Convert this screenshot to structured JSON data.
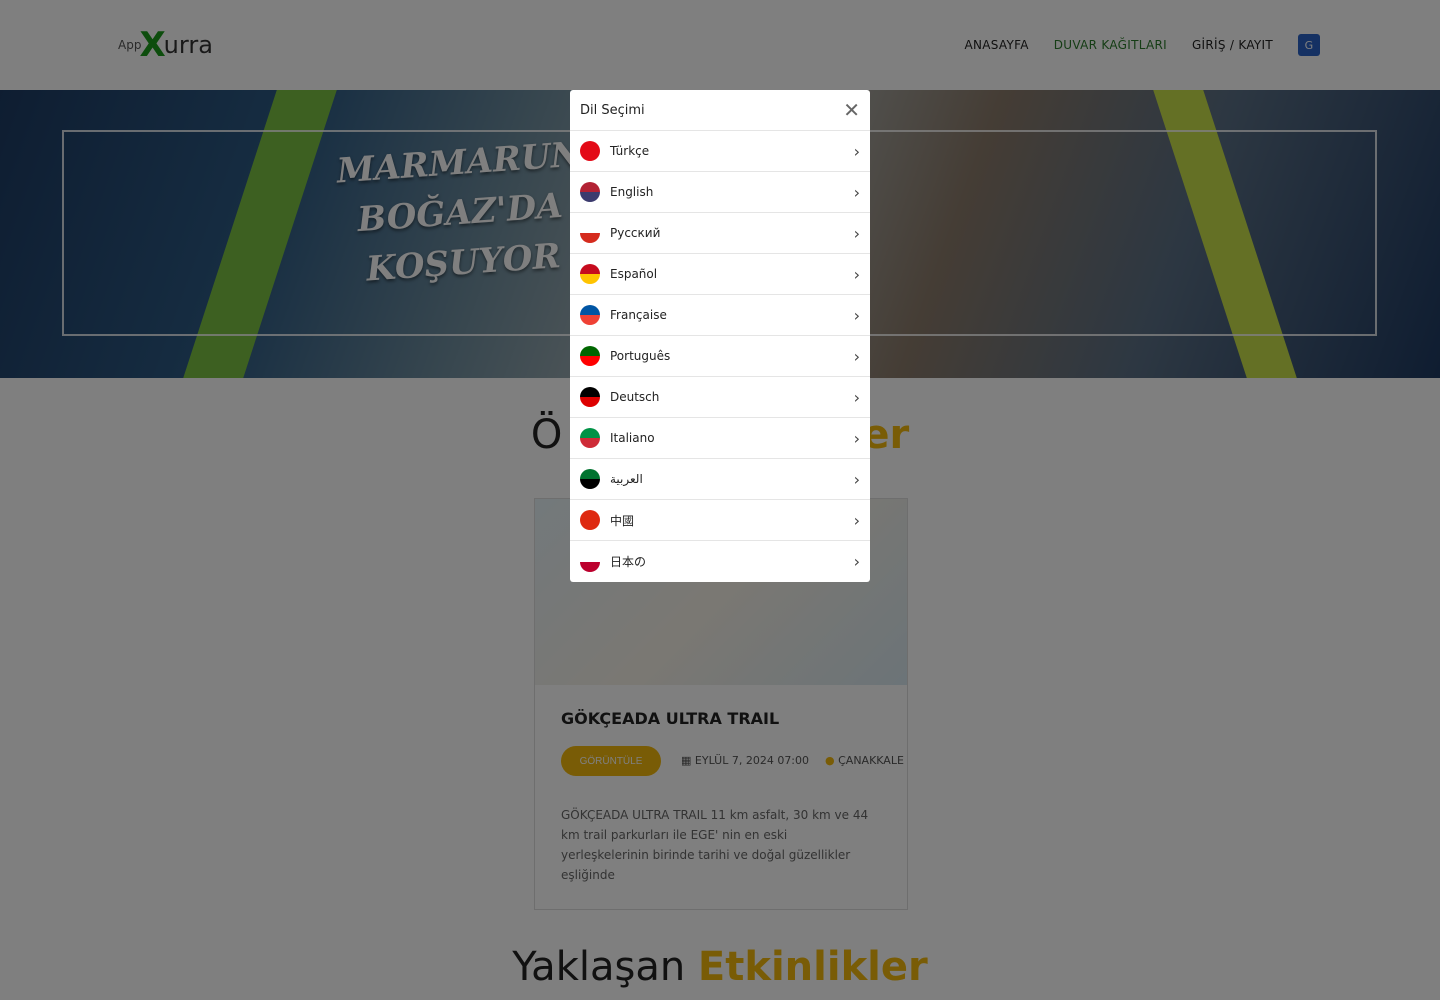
{
  "header": {
    "logo_text": "AppXurra",
    "logo_prefix": "App",
    "logo_x": "X",
    "logo_suffix": "urra",
    "nav": [
      {
        "label": "ANASAYFA"
      },
      {
        "label": "DUVAR KAĞITLARI",
        "active": true
      },
      {
        "label": "GİRİŞ / KAYIT"
      }
    ],
    "translate_icon": "google-translate-icon"
  },
  "banner": {
    "alt_lettering": "MARMARUN BOĞAZ'DA KOŞUYOR"
  },
  "featured": {
    "title_part1": "Ö",
    "title_part2": "er",
    "card": {
      "title": "GÖKÇEADA ULTRA TRAIL",
      "button": "GÖRÜNTÜLE",
      "date": "EYLÜL 7, 2024 07:00",
      "location": "ÇANAKKALE",
      "description": "GÖKÇEADA ULTRA TRAIL 11 km asfalt, 30 km ve 44 km trail parkurları ile EGE' nin en eski yerleşkelerinin birinde tarihi ve doğal güzellikler eşliğinde"
    }
  },
  "upcoming": {
    "title_part1": "Yaklaşan",
    "title_part2": "Etkinlikler"
  },
  "modal": {
    "title": "Dil Seçimi",
    "languages": [
      {
        "label": "Türkçe",
        "flag": [
          "#e30a17",
          "#e30a17"
        ]
      },
      {
        "label": "English",
        "flag": [
          "#b22234",
          "#3c3b6e"
        ]
      },
      {
        "label": "Русский",
        "flag": [
          "#ffffff",
          "#d52b1e"
        ]
      },
      {
        "label": "Español",
        "flag": [
          "#c60b1e",
          "#ffc400"
        ]
      },
      {
        "label": "Française",
        "flag": [
          "#0055a4",
          "#ef4135"
        ]
      },
      {
        "label": "Português",
        "flag": [
          "#006600",
          "#ff0000"
        ]
      },
      {
        "label": "Deutsch",
        "flag": [
          "#000000",
          "#dd0000"
        ]
      },
      {
        "label": "Italiano",
        "flag": [
          "#009246",
          "#ce2b37"
        ]
      },
      {
        "label": "العربية",
        "flag": [
          "#00732f",
          "#000000"
        ]
      },
      {
        "label": "中國",
        "flag": [
          "#de2910",
          "#de2910"
        ]
      },
      {
        "label": "日本の",
        "flag": [
          "#ffffff",
          "#bc002d"
        ]
      }
    ]
  },
  "colors": {
    "accent": "#f2b90c",
    "nav_active": "#2a7a2a",
    "overlay": "rgba(0,0,0,0.5)"
  }
}
